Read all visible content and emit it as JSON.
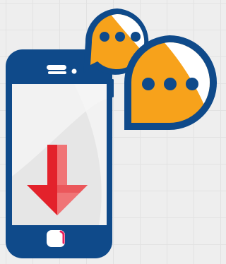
{
  "illustration": {
    "subject": "smartphone-download-with-chat-bubbles",
    "icons": [
      "smartphone-icon",
      "download-arrow-icon",
      "chat-bubble-icon",
      "chat-bubble-icon"
    ]
  },
  "colors": {
    "background": "#eeeeee",
    "grid_line": "#e2e2e2",
    "phone_body": "#0f4a8a",
    "phone_screen": "#e6e6e6",
    "phone_screen_highlight": "#f4f4f4",
    "arrow_red": "#e3222b",
    "arrow_light": "#f07476",
    "home_button_accent": "#e8215c",
    "bubble_outline": "#0f4a8a",
    "bubble_fill_orange": "#f7a21b",
    "bubble_fill_white": "#ffffff",
    "bubble_dots": "#0f4a8a"
  }
}
